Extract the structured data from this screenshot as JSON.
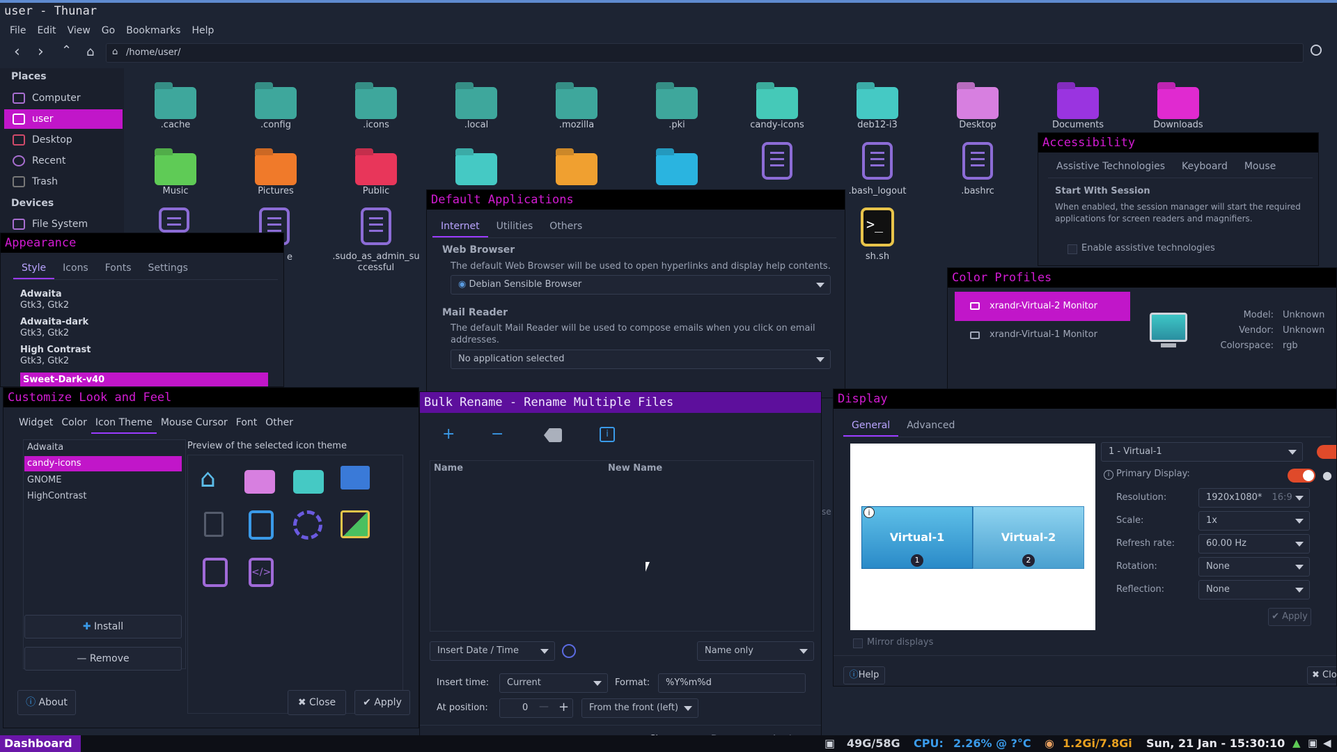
{
  "thunar": {
    "title": "user - Thunar",
    "menu": [
      "File",
      "Edit",
      "View",
      "Go",
      "Bookmarks",
      "Help"
    ],
    "path": "/home/user/",
    "places_header": "Places",
    "places": [
      "Computer",
      "user",
      "Desktop",
      "Recent",
      "Trash"
    ],
    "devices_header": "Devices",
    "devices": [
      "File System"
    ],
    "row1": [
      ".cache",
      ".config",
      ".icons",
      ".local",
      ".mozilla",
      ".pki",
      "candy-icons",
      "deb12-i3",
      "Desktop",
      "Documents",
      "Downloads"
    ],
    "row2": [
      "Music",
      "Pictures",
      "Public",
      ".bash_logout",
      ".bashrc"
    ],
    "row3": [
      ".sudo_as_admin_successful",
      "sh.sh"
    ],
    "partial_label": "e"
  },
  "default_apps": {
    "title": "Default Applications",
    "tabs": [
      "Internet",
      "Utilities",
      "Others"
    ],
    "web_header": "Web Browser",
    "web_desc": "The default Web Browser will be used to open hyperlinks and display help contents.",
    "web_value": "Debian Sensible Browser",
    "mail_header": "Mail Reader",
    "mail_desc": "The default Mail Reader will be used to compose emails when you click on email addresses.",
    "mail_value": "No application selected"
  },
  "accessibility": {
    "title": "Accessibility",
    "tabs": [
      "Assistive Technologies",
      "Keyboard",
      "Mouse"
    ],
    "header": "Start With Session",
    "desc": "When enabled, the session manager will start the required applications for screen readers and magnifiers.",
    "checkbox": "Enable assistive technologies"
  },
  "color_profiles": {
    "title": "Color Profiles",
    "devices": [
      "xrandr-Virtual-2 Monitor",
      "xrandr-Virtual-1 Monitor"
    ],
    "model_label": "Model:",
    "model": "Unknown",
    "vendor_label": "Vendor:",
    "vendor": "Unknown",
    "colorspace_label": "Colorspace:",
    "colorspace": "rgb"
  },
  "appearance": {
    "title": "Appearance",
    "tabs": [
      "Style",
      "Icons",
      "Fonts",
      "Settings"
    ],
    "themes": [
      {
        "name": "Adwaita",
        "sub": "Gtk3, Gtk2"
      },
      {
        "name": "Adwaita-dark",
        "sub": "Gtk3, Gtk2"
      },
      {
        "name": "High Contrast",
        "sub": "Gtk3, Gtk2"
      },
      {
        "name": "Sweet-Dark-v40",
        "sub": ""
      }
    ]
  },
  "customize": {
    "title": "Customize Look and Feel",
    "tabs": [
      "Widget",
      "Color",
      "Icon Theme",
      "Mouse Cursor",
      "Font",
      "Other"
    ],
    "themes": [
      "Adwaita",
      "candy-icons",
      "GNOME",
      "HighContrast"
    ],
    "preview_label": "Preview of the selected icon theme",
    "install": "Install",
    "remove": "Remove",
    "about": "About",
    "close": "Close",
    "apply": "Apply"
  },
  "bulk_rename": {
    "title": "Bulk Rename - Rename Multiple Files",
    "col_name": "Name",
    "col_new": "New Name",
    "mode": "Insert Date / Time",
    "scope": "Name only",
    "insert_time_label": "Insert time:",
    "insert_time": "Current",
    "format_label": "Format:",
    "format": "%Y%m%d",
    "position_label": "At position:",
    "position": "0",
    "from": "From the front (left)",
    "close": "Close",
    "done": "Done",
    "apply": "Apply",
    "behind_text": "se"
  },
  "display": {
    "title": "Display",
    "tabs": [
      "General",
      "Advanced"
    ],
    "monitors": [
      {
        "name": "Virtual-1",
        "num": "1"
      },
      {
        "name": "Virtual-2",
        "num": "2"
      }
    ],
    "output": "1 - Virtual-1",
    "primary_label": "Primary Display:",
    "resolution_label": "Resolution:",
    "resolution": "1920x1080*",
    "ratio": "16:9",
    "scale_label": "Scale:",
    "scale": "1x",
    "refresh_label": "Refresh rate:",
    "refresh": "60.00 Hz",
    "rotation_label": "Rotation:",
    "rotation": "None",
    "reflection_label": "Reflection:",
    "reflection": "None",
    "apply": "Apply",
    "mirror": "Mirror displays",
    "help": "Help",
    "close": "Clo"
  },
  "panel": {
    "dashboard": "Dashboard",
    "disk": "49G/58G",
    "cpu_label": "CPU:",
    "cpu": "2.26% @ ?°C",
    "mem": "1.2Gi/7.8Gi",
    "clock": "Sun, 21 Jan - 15:30:10"
  },
  "colors": {
    "accent": "#c311d6",
    "title_purple": "#5d0f9c",
    "selection": "#c116c9"
  }
}
